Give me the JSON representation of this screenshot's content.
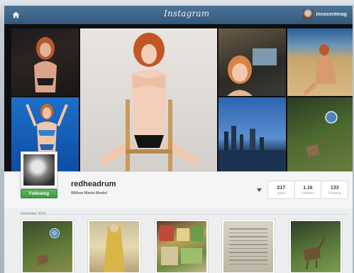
{
  "app": {
    "title": "Instagram"
  },
  "topbar": {
    "home_icon": "home-icon",
    "brand": "Instagram",
    "user": {
      "name": "innocentmag",
      "avatar": "avatar"
    }
  },
  "profile": {
    "username": "redheadrum",
    "full_name": "Willow Marie-Model",
    "follow_button": "Following",
    "stats": [
      {
        "value": "217",
        "label": "posts"
      },
      {
        "value": "1.1k",
        "label": "followers"
      },
      {
        "value": "133",
        "label": "following"
      }
    ]
  },
  "feed": {
    "section_label": "December 2014",
    "thumbnails": [
      {
        "id": "deer-on-grass"
      },
      {
        "id": "yellow-dress"
      },
      {
        "id": "grocery-shelf"
      },
      {
        "id": "newspaper-clipping"
      },
      {
        "id": "deer-in-park"
      }
    ]
  },
  "colors": {
    "topbar": "#3d6286",
    "follow_green": "#4cae4c",
    "background": "#eceeef"
  }
}
